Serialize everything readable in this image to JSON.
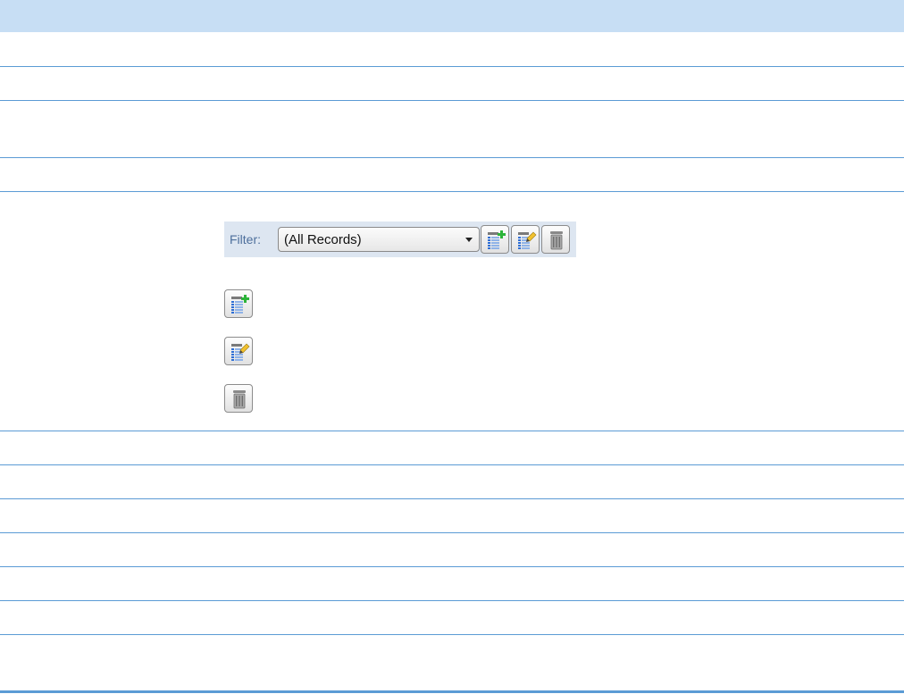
{
  "filter_toolbar": {
    "label": "Filter:",
    "selected_option": "(All Records)",
    "buttons": [
      {
        "icon": "add-filter-icon"
      },
      {
        "icon": "edit-filter-icon"
      },
      {
        "icon": "delete-filter-icon"
      }
    ]
  },
  "icon_legend": [
    {
      "icon": "add-filter-icon"
    },
    {
      "icon": "edit-filter-icon"
    },
    {
      "icon": "delete-filter-icon"
    }
  ],
  "colors": {
    "header_band": "#c7def4",
    "row_rule": "#5b9bd5",
    "toolbar_bg": "#dde6f1",
    "label_text": "#4d6f9c",
    "plus_green": "#2db43a",
    "pencil_yellow": "#f2c12e"
  }
}
